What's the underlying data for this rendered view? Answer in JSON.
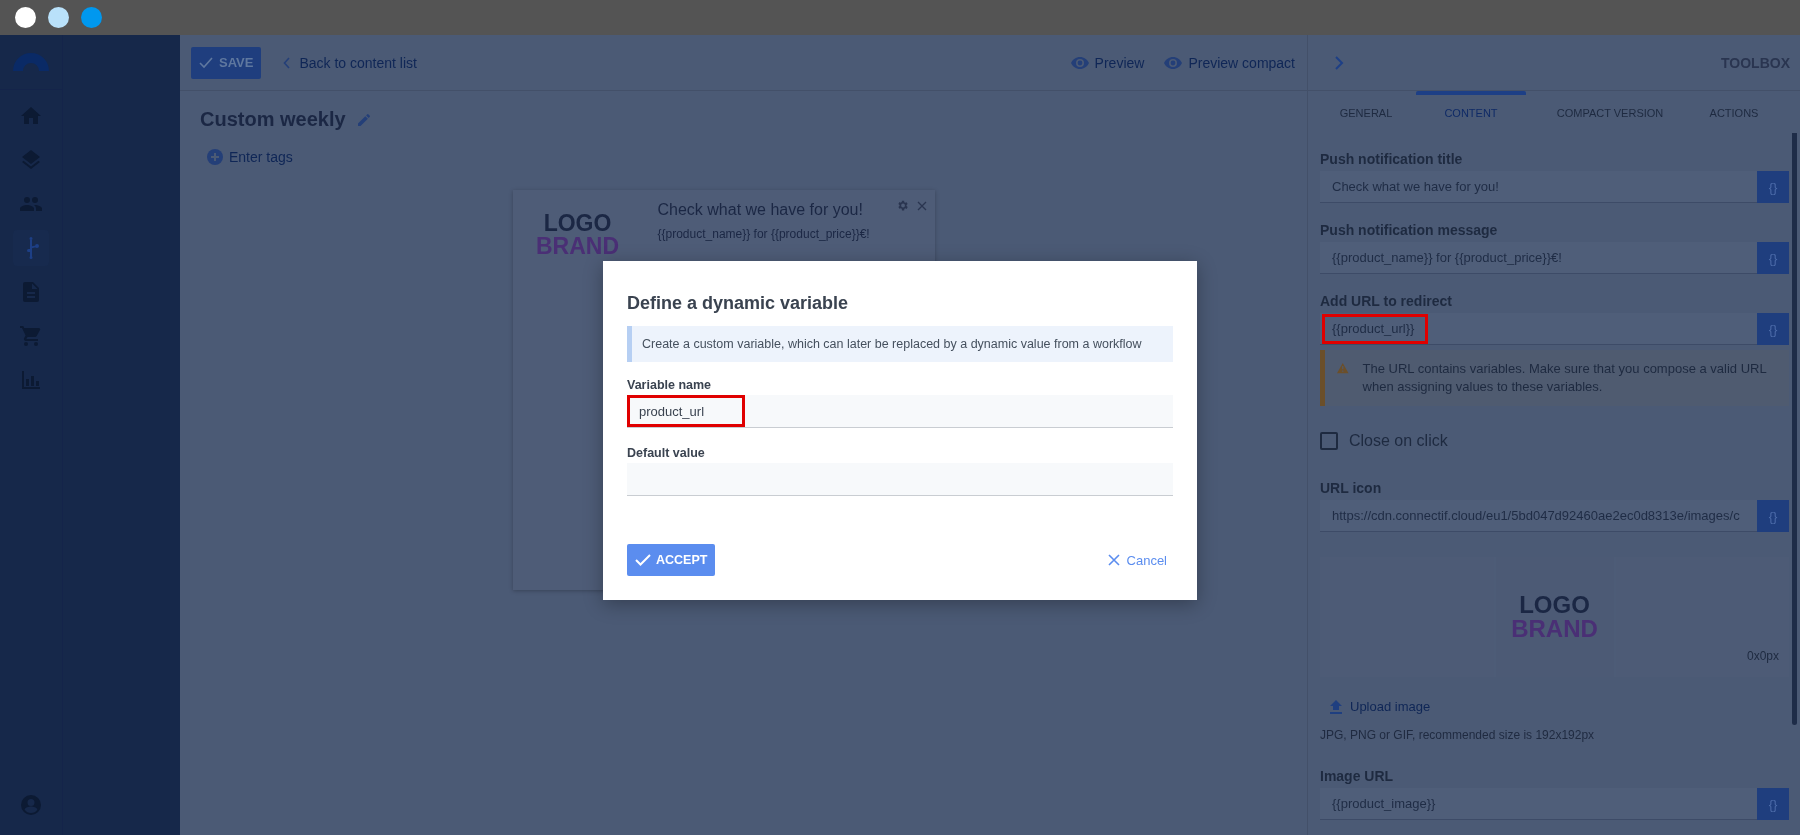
{
  "header": {
    "save": "SAVE",
    "back": "Back to content list",
    "preview": "Preview",
    "preview_compact": "Preview compact"
  },
  "sidebar": {
    "items": [
      {
        "kind": "home",
        "selected": false
      },
      {
        "kind": "layers",
        "selected": false
      },
      {
        "kind": "people",
        "selected": false
      },
      {
        "kind": "flow",
        "selected": true
      },
      {
        "kind": "document",
        "selected": false
      },
      {
        "kind": "cart",
        "selected": false
      },
      {
        "kind": "chart",
        "selected": false
      }
    ]
  },
  "content": {
    "title": "Custom weekly",
    "tags": "Enter tags",
    "card": {
      "logo_top": "LOGO",
      "logo_bottom": "BRAND",
      "title": "Check what we have for you!",
      "message": "{{product_name}} for {{product_price}}€!"
    }
  },
  "toolbox": {
    "title": "TOOLBOX",
    "tabs": [
      {
        "label": "GENERAL",
        "selected": false
      },
      {
        "label": "CONTENT",
        "selected": true
      },
      {
        "label": "COMPACT VERSION",
        "selected": false
      },
      {
        "label": "ACTIONS",
        "selected": false
      }
    ],
    "items": [
      {
        "kind": "field",
        "label": "Push notification title",
        "value": "Check what we have for you!",
        "highlighted": false,
        "button": "{}"
      },
      {
        "kind": "field",
        "label": "Push notification message",
        "value": "{{product_name}} for {{product_price}}€!",
        "highlighted": false,
        "button": "{}"
      },
      {
        "kind": "field",
        "label": "Add URL to redirect",
        "value": "{{product_url}}",
        "highlighted": true,
        "button": "{}"
      },
      {
        "kind": "warning",
        "text": "The URL contains variables. Make sure that you compose a valid URL when assigning values to these variables."
      },
      {
        "kind": "checkbox",
        "label": "Close on click",
        "checked": false
      },
      {
        "kind": "field",
        "label": "URL icon",
        "value": "https://cdn.connectif.cloud/eu1/5bd047d92460ae2ec0d8313e/images/c",
        "highlighted": false,
        "button": "{}"
      },
      {
        "kind": "image",
        "logo_top": "LOGO",
        "logo_bottom": "BRAND",
        "size": "0x0px",
        "upload": "Upload image",
        "hint": "JPG, PNG or GIF, recommended size is 192x192px"
      },
      {
        "kind": "field",
        "label": "Image URL",
        "value": "{{product_image}}",
        "highlighted": false,
        "button": "{}"
      }
    ]
  },
  "dialog": {
    "title": "Define a dynamic variable",
    "info": "Create a custom variable, which can later be replaced by a dynamic value from a workflow",
    "fields": [
      {
        "label": "Variable name",
        "value": "product_url",
        "highlighted": true
      },
      {
        "label": "Default value",
        "highlighted": false
      }
    ],
    "accept": "ACCEPT",
    "cancel": "Cancel"
  }
}
